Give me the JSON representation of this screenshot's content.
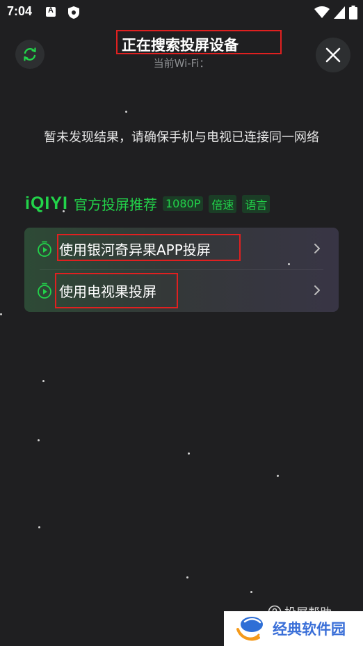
{
  "status_bar": {
    "time": "7:04"
  },
  "header": {
    "title": "正在搜索投屏设备",
    "wifi_label": "当前Wi-Fi："
  },
  "empty_message": "暂未发现结果，请确保手机与电视已连接同一网络",
  "recommend": {
    "logo": "iQIYI",
    "title": "官方投屏推荐",
    "tags": [
      "1080P",
      "倍速",
      "语言"
    ]
  },
  "options": [
    {
      "label": "使用银河奇异果APP投屏"
    },
    {
      "label": "使用电视果投屏"
    }
  ],
  "help": {
    "label": "投屏帮助"
  },
  "watermark": {
    "text": "经典软件园"
  },
  "colors": {
    "background": "#1f1f21",
    "accent_green": "#22d34a",
    "highlight_red": "#e02020"
  }
}
